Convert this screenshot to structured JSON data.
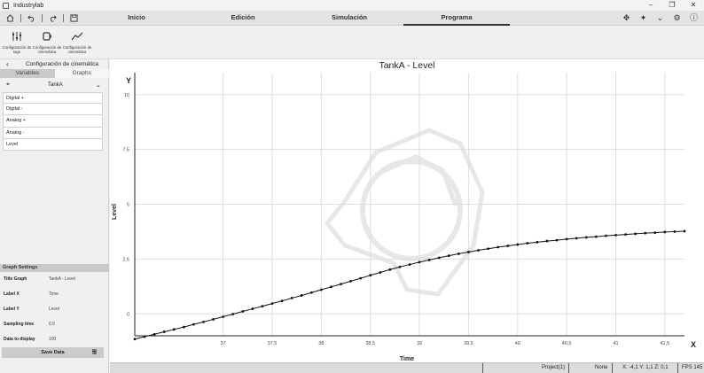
{
  "app": {
    "title": "Industrylab"
  },
  "window_controls": {
    "minimize": "–",
    "maximize": "❐",
    "close": "✕"
  },
  "menubar": {
    "left_icons": [
      "home-icon",
      "undo-icon",
      "redo-icon",
      "save-icon"
    ],
    "tabs": [
      {
        "label": "Inicio"
      },
      {
        "label": "Edición"
      },
      {
        "label": "Simulación"
      },
      {
        "label": "Programa",
        "active": true
      }
    ],
    "right_icons": [
      "move-icon",
      "snap-icon",
      "chevron-down-icon",
      "gear-icon",
      "help-icon"
    ]
  },
  "toolbar": {
    "tools": [
      {
        "label": "Configuración de tags",
        "icon": "sliders-icon"
      },
      {
        "label": "Configuración de cinemática",
        "icon": "device-icon"
      },
      {
        "label": "Configuración de cinemática",
        "icon": "trend-icon"
      }
    ]
  },
  "left_panel": {
    "header": "Configuración de cinemática",
    "tabs": [
      "Variables",
      "Graphs"
    ],
    "selected_object": "TankA",
    "variables": [
      "Digital +",
      "Digital -",
      "Analog +",
      "Analog -",
      "Level"
    ]
  },
  "graph_settings": {
    "title": "Graph Settings",
    "rows": [
      {
        "label": "Title Graph",
        "value": "TankA - Level"
      },
      {
        "label": "Label X",
        "value": "Time"
      },
      {
        "label": "Label Y",
        "value": "Level"
      },
      {
        "label": "Sampling time",
        "value": "0.5"
      },
      {
        "label": "Data to display",
        "value": "100"
      }
    ],
    "save_label": "Save Data"
  },
  "chart_data": {
    "type": "line",
    "title": "TankA - Level",
    "xlabel": "Time",
    "ylabel": "Level",
    "x_axis_letter": "X",
    "y_axis_letter": "Y",
    "xlim": [
      36.1,
      41.7
    ],
    "ylim": [
      -1.0,
      11.0
    ],
    "x_ticks": [
      37,
      37.5,
      38,
      38.5,
      39,
      39.5,
      40,
      40.5,
      41,
      41.5
    ],
    "x_tick_labels": [
      "37",
      "37,5",
      "38",
      "38,5",
      "39",
      "39,5",
      "40",
      "40,5",
      "41",
      "41,5"
    ],
    "y_ticks": [
      0,
      2.5,
      5,
      7.5,
      10
    ],
    "y_tick_labels": [
      "0",
      "2,5",
      "5",
      "7,5",
      "10"
    ],
    "grid": true,
    "series": [
      {
        "color": "#111111",
        "x": [
          36.1,
          36.2,
          36.3,
          36.4,
          36.5,
          36.6,
          36.7,
          36.8,
          36.9,
          37.0,
          37.1,
          37.2,
          37.3,
          37.4,
          37.5,
          37.6,
          37.7,
          37.8,
          37.9,
          38.0,
          38.1,
          38.2,
          38.3,
          38.4,
          38.5,
          38.6,
          38.7,
          38.8,
          38.9,
          39.0,
          39.1,
          39.2,
          39.3,
          39.4,
          39.5,
          39.6,
          39.7,
          39.8,
          39.9,
          40.0,
          40.1,
          40.2,
          40.3,
          40.4,
          40.5,
          40.6,
          40.7,
          40.8,
          40.9,
          41.0,
          41.1,
          41.2,
          41.3,
          41.4,
          41.5,
          41.6,
          41.7
        ],
        "y": [
          -1.15,
          -1.04,
          -0.93,
          -0.82,
          -0.71,
          -0.6,
          -0.48,
          -0.37,
          -0.25,
          -0.13,
          -0.01,
          0.11,
          0.23,
          0.35,
          0.47,
          0.59,
          0.72,
          0.84,
          0.97,
          1.1,
          1.23,
          1.36,
          1.49,
          1.62,
          1.76,
          1.89,
          2.02,
          2.14,
          2.25,
          2.36,
          2.46,
          2.56,
          2.65,
          2.74,
          2.82,
          2.9,
          2.97,
          3.04,
          3.1,
          3.16,
          3.22,
          3.27,
          3.32,
          3.36,
          3.41,
          3.45,
          3.49,
          3.52,
          3.56,
          3.59,
          3.62,
          3.65,
          3.68,
          3.7,
          3.73,
          3.75,
          3.77
        ]
      }
    ]
  },
  "statusbar": {
    "project": "Project(1)",
    "selection": "None",
    "coords": "X: -4,1  Y: 1,1  Z: 0,1",
    "fps": "FPS 145"
  }
}
